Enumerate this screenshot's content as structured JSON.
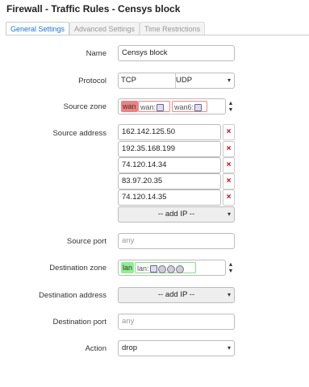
{
  "page": {
    "title": "Firewall - Traffic Rules - Censys block"
  },
  "tabs": [
    {
      "label": "General Settings"
    },
    {
      "label": "Advanced Settings"
    },
    {
      "label": "Time Restrictions"
    }
  ],
  "form": {
    "name": {
      "label": "Name",
      "value": "Censys block"
    },
    "protocol": {
      "label": "Protocol",
      "values": [
        "TCP",
        "UDP"
      ]
    },
    "source_zone": {
      "label": "Source zone",
      "zone": "wan",
      "networks": [
        "wan:",
        "wan6:"
      ]
    },
    "source_address": {
      "label": "Source address",
      "values": [
        "162.142.125.50",
        "192.35.168.199",
        "74.120.14.34",
        "83.97.20.35",
        "74.120.14.35"
      ],
      "remove_label": "×",
      "add_label": "-- add IP --"
    },
    "source_port": {
      "label": "Source port",
      "placeholder": "any"
    },
    "destination_zone": {
      "label": "Destination zone",
      "zone": "lan",
      "networks": [
        "lan:"
      ]
    },
    "destination_address": {
      "label": "Destination address",
      "add_label": "-- add IP --"
    },
    "destination_port": {
      "label": "Destination port",
      "placeholder": "any"
    },
    "action": {
      "label": "Action",
      "value": "drop"
    }
  },
  "icons": {
    "dropdown": "▾",
    "spinner_up": "▲",
    "spinner_down": "▼"
  },
  "colors": {
    "wan_zone": "#f08080",
    "lan_zone": "#90ee90",
    "active_tab": "#1a73e8",
    "remove": "#cc0000"
  }
}
